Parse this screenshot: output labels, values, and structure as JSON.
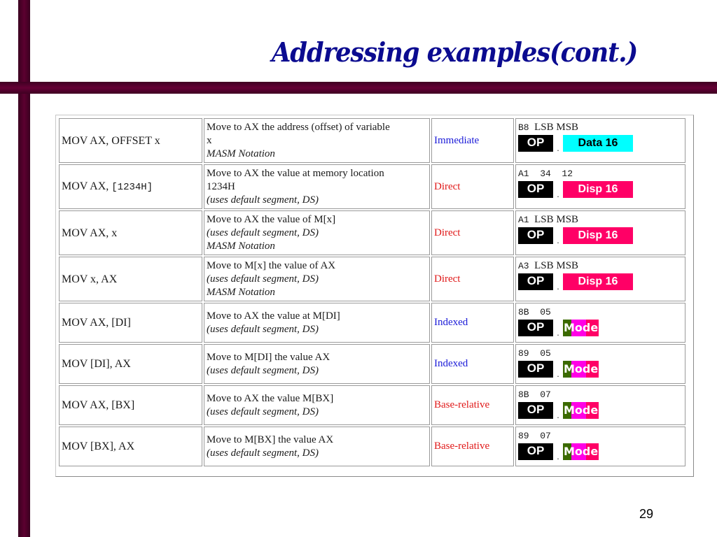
{
  "slide": {
    "title": "Addressing examples(cont.)",
    "page_number": "29"
  },
  "colors": {
    "frame_bar": "#5c0030",
    "title": "#0b0b90",
    "mode_blue": "#1a1ad8",
    "mode_red": "#e01818",
    "data16_bg": "#00ffff",
    "disp16_bg": "#ff0066",
    "mode_box": [
      "#3b6a00",
      "#ff00e6",
      "#ff0066"
    ]
  },
  "table": {
    "rows": [
      {
        "instr_prefix": "MOV AX, OFFSET x",
        "instr_mono": "",
        "desc": [
          "Move to AX the address (offset) of variable",
          "x"
        ],
        "desc_italic": [
          "MASM Notation"
        ],
        "mode": "Immediate",
        "mode_color": "blue",
        "enc_bytes_mono": "B8",
        "enc_bytes_text": "  LSB MSB",
        "op_label": "OP",
        "field_label": "Data 16",
        "field_kind": "data16"
      },
      {
        "instr_prefix": "MOV AX, ",
        "instr_mono": "[1234H]",
        "desc": [
          "Move to AX the value at memory location",
          "1234H"
        ],
        "desc_italic": [
          "(uses default segment, DS)"
        ],
        "mode": "Direct",
        "mode_color": "red",
        "enc_bytes_mono": "A1  34  12",
        "enc_bytes_text": "",
        "op_label": "OP",
        "field_label": "Disp 16",
        "field_kind": "disp16"
      },
      {
        "instr_prefix": "MOV AX, x",
        "instr_mono": "",
        "desc": [
          "Move to AX the value of M[x]"
        ],
        "desc_italic": [
          "(uses default segment, DS)",
          "MASM Notation"
        ],
        "mode": "Direct",
        "mode_color": "red",
        "enc_bytes_mono": "A1",
        "enc_bytes_text": "  LSB MSB",
        "op_label": "OP",
        "field_label": "Disp 16",
        "field_kind": "disp16"
      },
      {
        "instr_prefix": "MOV x, AX",
        "instr_mono": "",
        "desc": [
          "Move to M[x] the value of AX"
        ],
        "desc_italic": [
          "(uses default segment, DS)",
          "MASM Notation"
        ],
        "mode": "Direct",
        "mode_color": "red",
        "enc_bytes_mono": "A3",
        "enc_bytes_text": "  LSB MSB",
        "op_label": "OP",
        "field_label": "Disp 16",
        "field_kind": "disp16"
      },
      {
        "instr_prefix": "MOV AX, [DI]",
        "instr_mono": "",
        "desc": [
          "Move to AX the value at M[DI]"
        ],
        "desc_italic": [
          "(uses default segment, DS)"
        ],
        "mode": "Indexed",
        "mode_color": "blue",
        "enc_bytes_mono": "8B  05",
        "enc_bytes_text": "",
        "op_label": "OP",
        "field_label": "Mode",
        "field_kind": "mode"
      },
      {
        "instr_prefix": "MOV [DI], AX",
        "instr_mono": "",
        "desc": [
          "Move to M[DI] the value AX"
        ],
        "desc_italic": [
          "(uses default segment, DS)"
        ],
        "mode": "Indexed",
        "mode_color": "blue",
        "enc_bytes_mono": "89  05",
        "enc_bytes_text": "",
        "op_label": "OP",
        "field_label": "Mode",
        "field_kind": "mode"
      },
      {
        "instr_prefix": "MOV AX, [BX]",
        "instr_mono": "",
        "desc": [
          "Move to AX the value M[BX]"
        ],
        "desc_italic": [
          "(uses default segment, DS)"
        ],
        "mode": "Base-relative",
        "mode_color": "red",
        "enc_bytes_mono": "8B  07",
        "enc_bytes_text": "",
        "op_label": "OP",
        "field_label": "Mode",
        "field_kind": "mode"
      },
      {
        "instr_prefix": "MOV [BX], AX",
        "instr_mono": "",
        "desc": [
          "Move to M[BX] the value AX"
        ],
        "desc_italic": [
          "(uses default segment, DS)"
        ],
        "mode": "Base-relative",
        "mode_color": "red",
        "enc_bytes_mono": "89  07",
        "enc_bytes_text": "",
        "op_label": "OP",
        "field_label": "Mode",
        "field_kind": "mode"
      }
    ]
  }
}
